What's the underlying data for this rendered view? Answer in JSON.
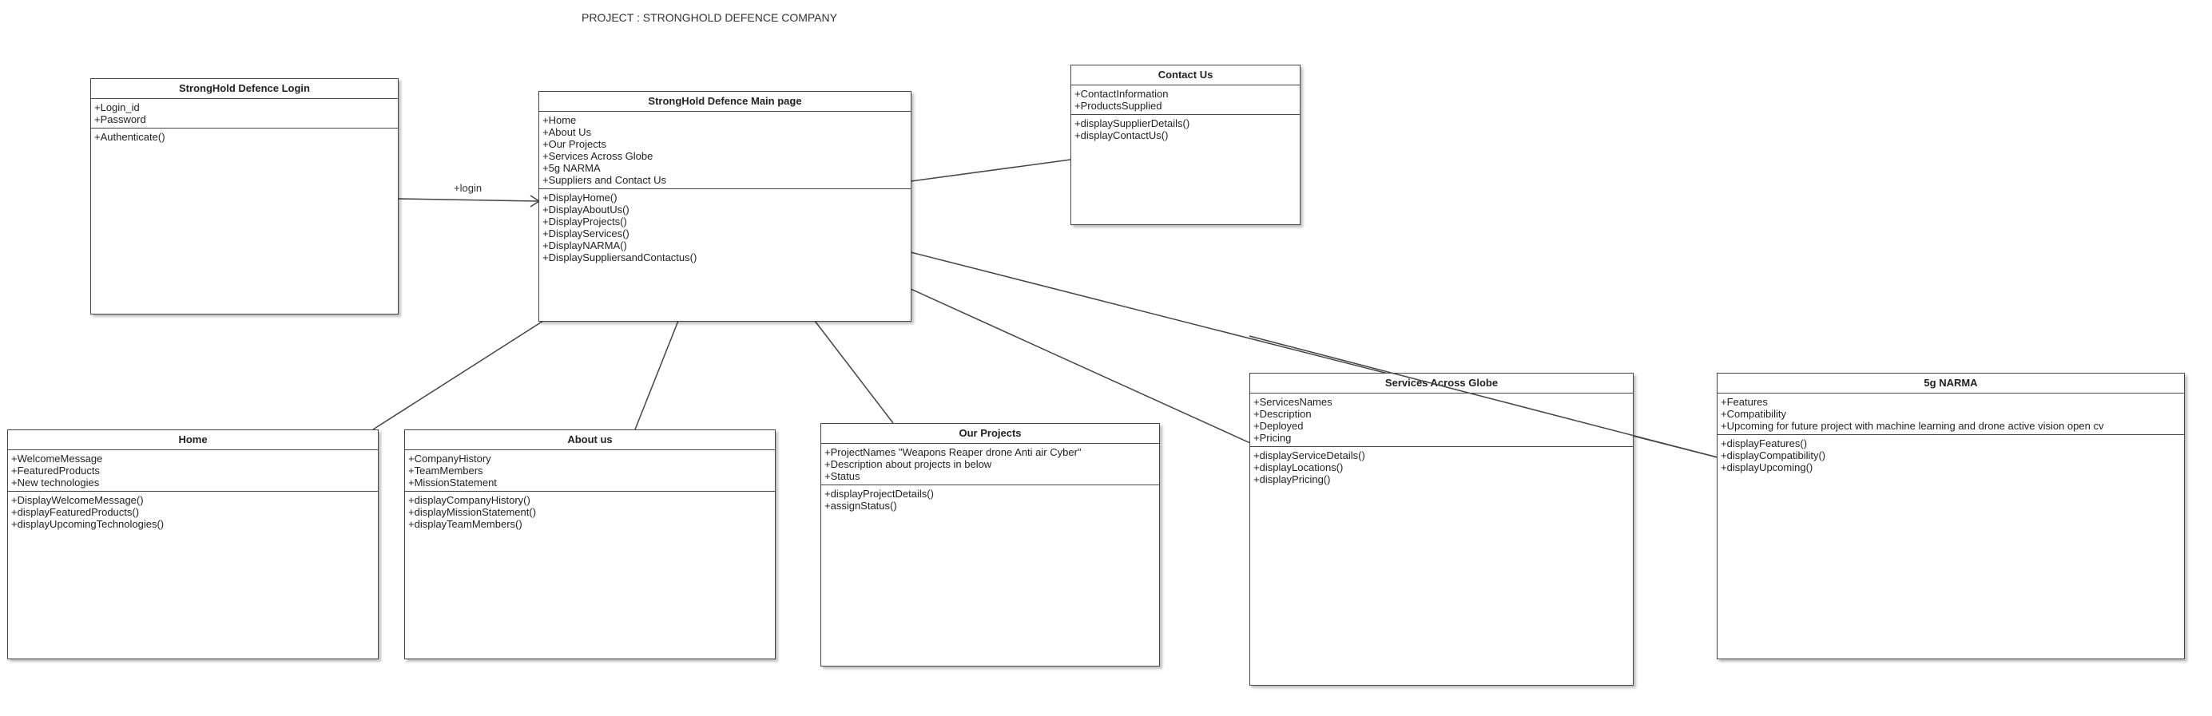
{
  "diagram_title": "PROJECT : STRONGHOLD DEFENCE COMPANY",
  "classes": {
    "login": {
      "name": "StrongHold Defence Login",
      "attributes": [
        "+Login_id",
        "+Password"
      ],
      "methods": [
        "+Authenticate()"
      ]
    },
    "main": {
      "name": "StrongHold Defence Main page",
      "attributes": [
        "+Home",
        "+About Us",
        "+Our Projects",
        "+Services Across Globe",
        "+5g NARMA",
        "+Suppliers and Contact Us"
      ],
      "methods": [
        "+DisplayHome()",
        "+DisplayAboutUs()",
        "+DisplayProjects()",
        "+DisplayServices()",
        "+DisplayNARMA()",
        "+DisplaySuppliersandContactus()"
      ]
    },
    "contact": {
      "name": "Contact Us",
      "attributes": [
        "+ContactInformation",
        "+ProductsSupplied"
      ],
      "methods": [
        "+displaySupplierDetails()",
        "+displayContactUs()"
      ]
    },
    "home": {
      "name": "Home",
      "attributes": [
        "+WelcomeMessage",
        "+FeaturedProducts",
        "+New technologies"
      ],
      "methods": [
        "+DisplayWelcomeMessage()",
        "+displayFeaturedProducts()",
        "+displayUpcomingTechnologies()"
      ]
    },
    "about": {
      "name": "About us",
      "attributes": [
        "+CompanyHistory",
        "+TeamMembers",
        "+MissionStatement"
      ],
      "methods": [
        "+displayCompanyHistory()",
        "+displayMissionStatement()",
        "+displayTeamMembers()"
      ]
    },
    "projects": {
      "name": "Our Projects",
      "attributes": [
        "+ProjectNames \"Weapons Reaper drone Anti air Cyber\"",
        "+Description about projects in below",
        "+Status"
      ],
      "methods": [
        "+displayProjectDetails()",
        "+assignStatus()"
      ]
    },
    "services": {
      "name": "Services Across Globe",
      "attributes": [
        "+ServicesNames",
        "+Description",
        "+Deployed",
        "+Pricing"
      ],
      "methods": [
        "+displayServiceDetails()",
        "+displayLocations()",
        "+displayPricing()"
      ]
    },
    "narma": {
      "name": "5g NARMA",
      "attributes": [
        "+Features",
        "+Compatibility",
        "+Upcoming for future project with machine learning and drone active vision open cv"
      ],
      "methods": [
        "+displayFeatures()",
        "+displayCompatibility()",
        "+displayUpcoming()"
      ]
    }
  },
  "edges": {
    "login_main_label": "+login"
  },
  "colors": {
    "line": "#444444",
    "box_fill": "#ffffff"
  }
}
